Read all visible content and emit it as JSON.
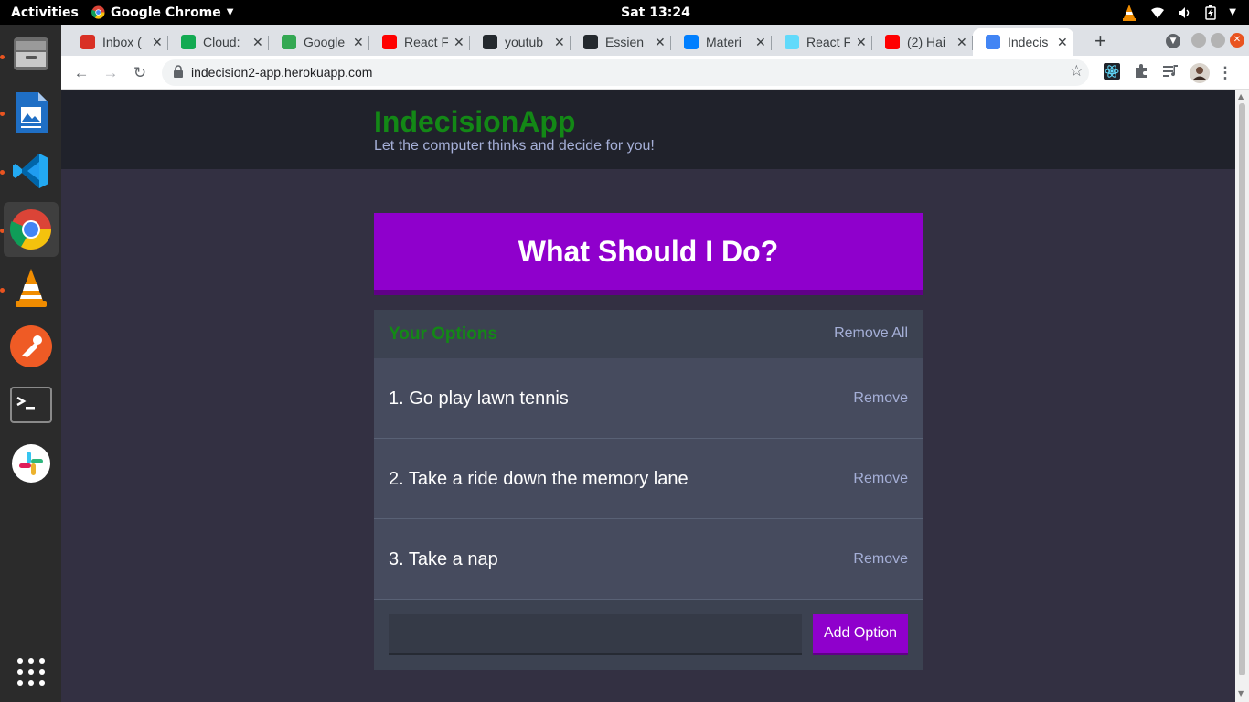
{
  "topbar": {
    "activities": "Activities",
    "app_name": "Google Chrome",
    "clock": "Sat 13:24"
  },
  "dock": {
    "items": [
      "files-icon",
      "writer-icon",
      "vscode-icon",
      "chrome-icon",
      "vlc-icon",
      "postman-icon",
      "terminal-icon",
      "slack-icon",
      "show-apps-icon"
    ]
  },
  "browser": {
    "tabs": [
      {
        "label": "Inbox (",
        "icon": "gmail-icon",
        "color": "#d93025"
      },
      {
        "label": "Cloud:",
        "icon": "mongodb-icon",
        "color": "#13aa52"
      },
      {
        "label": "Google",
        "icon": "google-maps-icon",
        "color": "#34a853"
      },
      {
        "label": "React F",
        "icon": "youtube-icon",
        "color": "#ff0000"
      },
      {
        "label": "youtub",
        "icon": "github-icon",
        "color": "#24292e"
      },
      {
        "label": "Essien",
        "icon": "github-icon",
        "color": "#24292e"
      },
      {
        "label": "Materi",
        "icon": "material-ui-icon",
        "color": "#007fff"
      },
      {
        "label": "React F",
        "icon": "react-icon",
        "color": "#61dafb"
      },
      {
        "label": "(2) Hai",
        "icon": "youtube-icon",
        "color": "#ff0000"
      },
      {
        "label": "Indecis",
        "icon": "chrome-favicon-icon",
        "color": "#4285f4",
        "active": true
      }
    ],
    "new_tab": "+",
    "url": "indecision2-app.herokuapp.com"
  },
  "app": {
    "title": "IndecisionApp",
    "subtitle": "Let the computer thinks and decide for you!",
    "pick_button": "What Should I Do?",
    "options_title": "Your Options",
    "remove_all": "Remove All",
    "options": [
      {
        "text": "1. Go play lawn tennis",
        "remove": "Remove"
      },
      {
        "text": "2. Take a ride down the memory lane",
        "remove": "Remove"
      },
      {
        "text": "3. Take a nap",
        "remove": "Remove"
      }
    ],
    "input_value": "",
    "add_button": "Add Option"
  },
  "colors": {
    "accent_purple": "#8f00cc",
    "title_green": "#138816",
    "muted_text": "#a5afd7"
  }
}
